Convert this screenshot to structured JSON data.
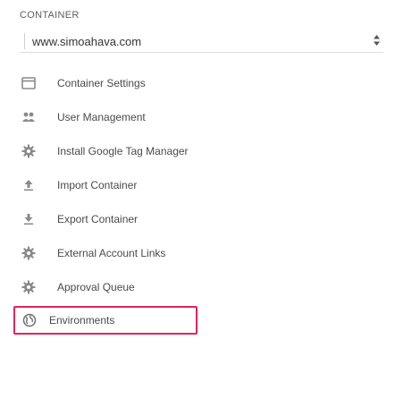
{
  "section": {
    "title": "CONTAINER"
  },
  "container_selector": {
    "value": "www.simoahava.com"
  },
  "menu": [
    {
      "label": "Container Settings",
      "icon": "window-icon"
    },
    {
      "label": "User Management",
      "icon": "users-icon"
    },
    {
      "label": "Install Google Tag Manager",
      "icon": "gear-icon"
    },
    {
      "label": "Import Container",
      "icon": "upload-icon"
    },
    {
      "label": "Export Container",
      "icon": "download-icon"
    },
    {
      "label": "External Account Links",
      "icon": "gear-icon"
    },
    {
      "label": "Approval Queue",
      "icon": "gear-icon"
    },
    {
      "label": "Environments",
      "icon": "globe-icon"
    }
  ],
  "colors": {
    "highlight_border": "#e0245e",
    "icon": "#8a8a8a"
  }
}
